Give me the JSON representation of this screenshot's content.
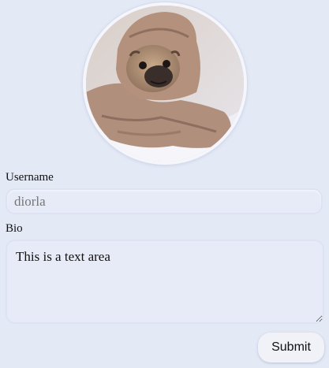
{
  "profile": {
    "avatar_icon": "pug-in-blanket-photo"
  },
  "form": {
    "username_label": "Username",
    "username_placeholder": "diorla",
    "bio_label": "Bio",
    "bio_value": "This is a text area",
    "submit_label": "Submit"
  },
  "colors": {
    "background": "#e4e9f6",
    "field_border": "#dde3f3",
    "placeholder": "#8f97b6"
  }
}
